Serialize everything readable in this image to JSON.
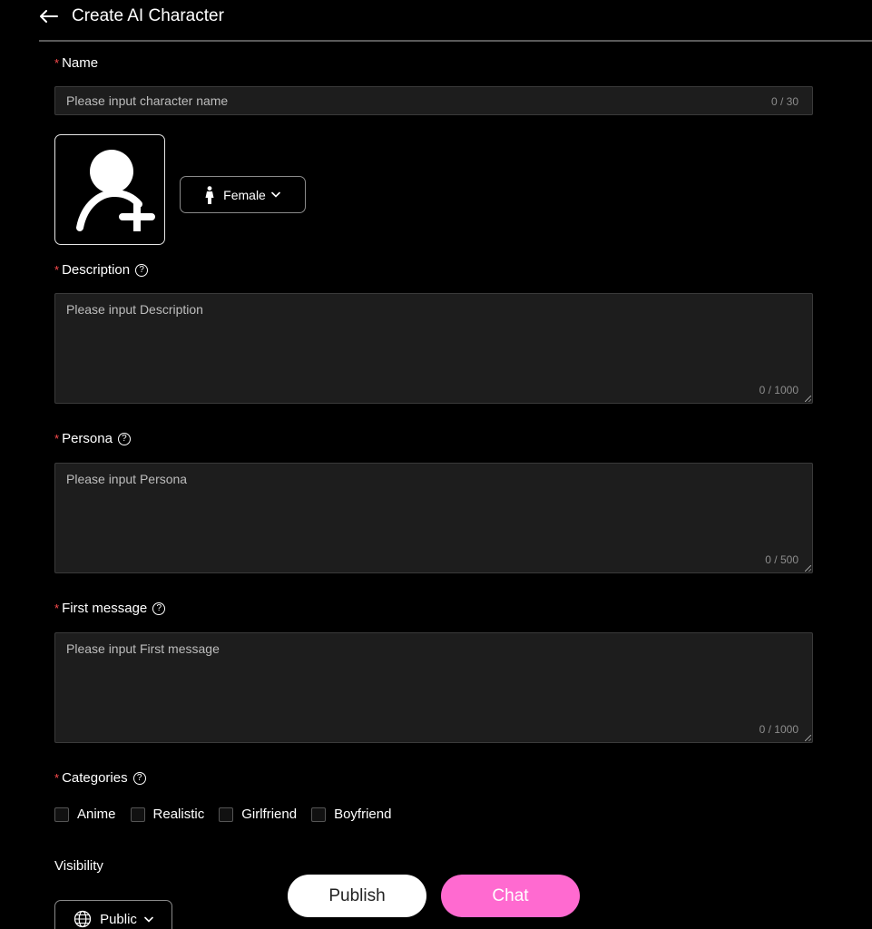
{
  "header": {
    "title": "Create AI Character"
  },
  "required_mark": "*",
  "help_glyph": "?",
  "name": {
    "label": "Name",
    "placeholder": "Please input character name",
    "counter": "0 / 30"
  },
  "gender": {
    "selected": "Female"
  },
  "description": {
    "label": "Description",
    "placeholder": "Please input Description",
    "counter": "0 / 1000"
  },
  "persona": {
    "label": "Persona",
    "placeholder": "Please input Persona",
    "counter": "0 / 500"
  },
  "first_message": {
    "label": "First message",
    "placeholder": "Please input First message",
    "counter": "0 / 1000"
  },
  "categories": {
    "label": "Categories",
    "items": [
      {
        "label": "Anime"
      },
      {
        "label": "Realistic"
      },
      {
        "label": "Girlfriend"
      },
      {
        "label": "Boyfriend"
      }
    ]
  },
  "visibility": {
    "label": "Visibility",
    "selected": "Public"
  },
  "actions": {
    "publish": "Publish",
    "chat": "Chat"
  },
  "colors": {
    "background": "#000000",
    "required": "#ff4d4f",
    "chat_button": "#ff6ad0",
    "input_bg": "#1d1d1d"
  },
  "icons": {
    "back": "arrow-left-icon",
    "avatar": "user-add-icon",
    "gender": "female-icon",
    "visibility": "globe-icon",
    "dropdown": "chevron-down-icon",
    "help": "question-circle-icon"
  }
}
